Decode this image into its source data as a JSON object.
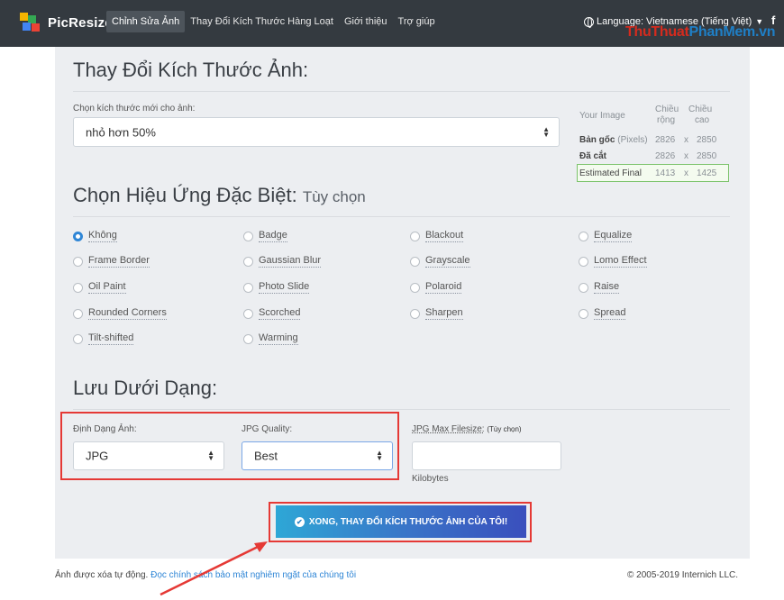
{
  "navbar": {
    "brand": "PicResize",
    "links": [
      "Chỉnh Sửa Ảnh",
      "Thay Đổi Kích Thước Hàng Loạt",
      "Giới thiệu",
      "Trợ giúp"
    ],
    "language": "Language: Vietnamese (Tiếng Việt)",
    "facebook": "f",
    "watermark_part1": "ThuThuat",
    "watermark_part2": "PhanMem",
    "watermark_part3": ".vn"
  },
  "resize": {
    "heading": "Thay Đổi Kích Thước Ảnh:",
    "label": "Chọn kích thước mới cho ảnh:",
    "selected": "nhỏ hơn 50%",
    "table": {
      "col_image": "Your Image",
      "col_width_1": "Chiều",
      "col_width_2": "rộng",
      "col_height_1": "Chiều",
      "col_height_2": "cao",
      "rows": [
        {
          "label": "Bản gốc",
          "suffix": "(Pixels)",
          "w": "2826",
          "x": "x",
          "h": "2850"
        },
        {
          "label": "Đã cắt",
          "suffix": "",
          "w": "2826",
          "x": "x",
          "h": "2850"
        },
        {
          "label": "Estimated Final",
          "suffix": "",
          "w": "1413",
          "x": "x",
          "h": "1425"
        }
      ]
    }
  },
  "effects": {
    "heading": "Chọn Hiệu Ứng Đặc Biệt:",
    "heading_small": "Tùy chọn",
    "options": [
      "Không",
      "Badge",
      "Blackout",
      "Equalize",
      "Frame Border",
      "Gaussian Blur",
      "Grayscale",
      "Lomo Effect",
      "Oil Paint",
      "Photo Slide",
      "Polaroid",
      "Raise",
      "Rounded Corners",
      "Scorched",
      "Sharpen",
      "Spread",
      "Tilt-shifted",
      "Warming"
    ],
    "selected": "Không"
  },
  "save": {
    "heading": "Lưu Dưới Dạng:",
    "format_label": "Định Dạng Ảnh:",
    "format_value": "JPG",
    "quality_label": "JPG Quality:",
    "quality_value": "Best",
    "maxsize_label": "JPG Max Filesize:",
    "maxsize_optional": "(Tùy chọn)",
    "maxsize_value": "",
    "unit": "Kilobytes",
    "submit": "XONG, THAY ĐỔI KÍCH THƯỚC ẢNH CỦA TÔI!"
  },
  "footer": {
    "note": "Ảnh được xóa tự động.",
    "policy_link": "Đọc chính sách bảo mật nghiêm ngặt của chúng tôi",
    "copyright": "© 2005-2019 Internich LLC."
  },
  "colors": {
    "navbar": "#343a40",
    "panel": "#eceef1",
    "accent": "#2f86d6",
    "highlight": "#e53935",
    "estimated_border": "#7cc36b"
  }
}
